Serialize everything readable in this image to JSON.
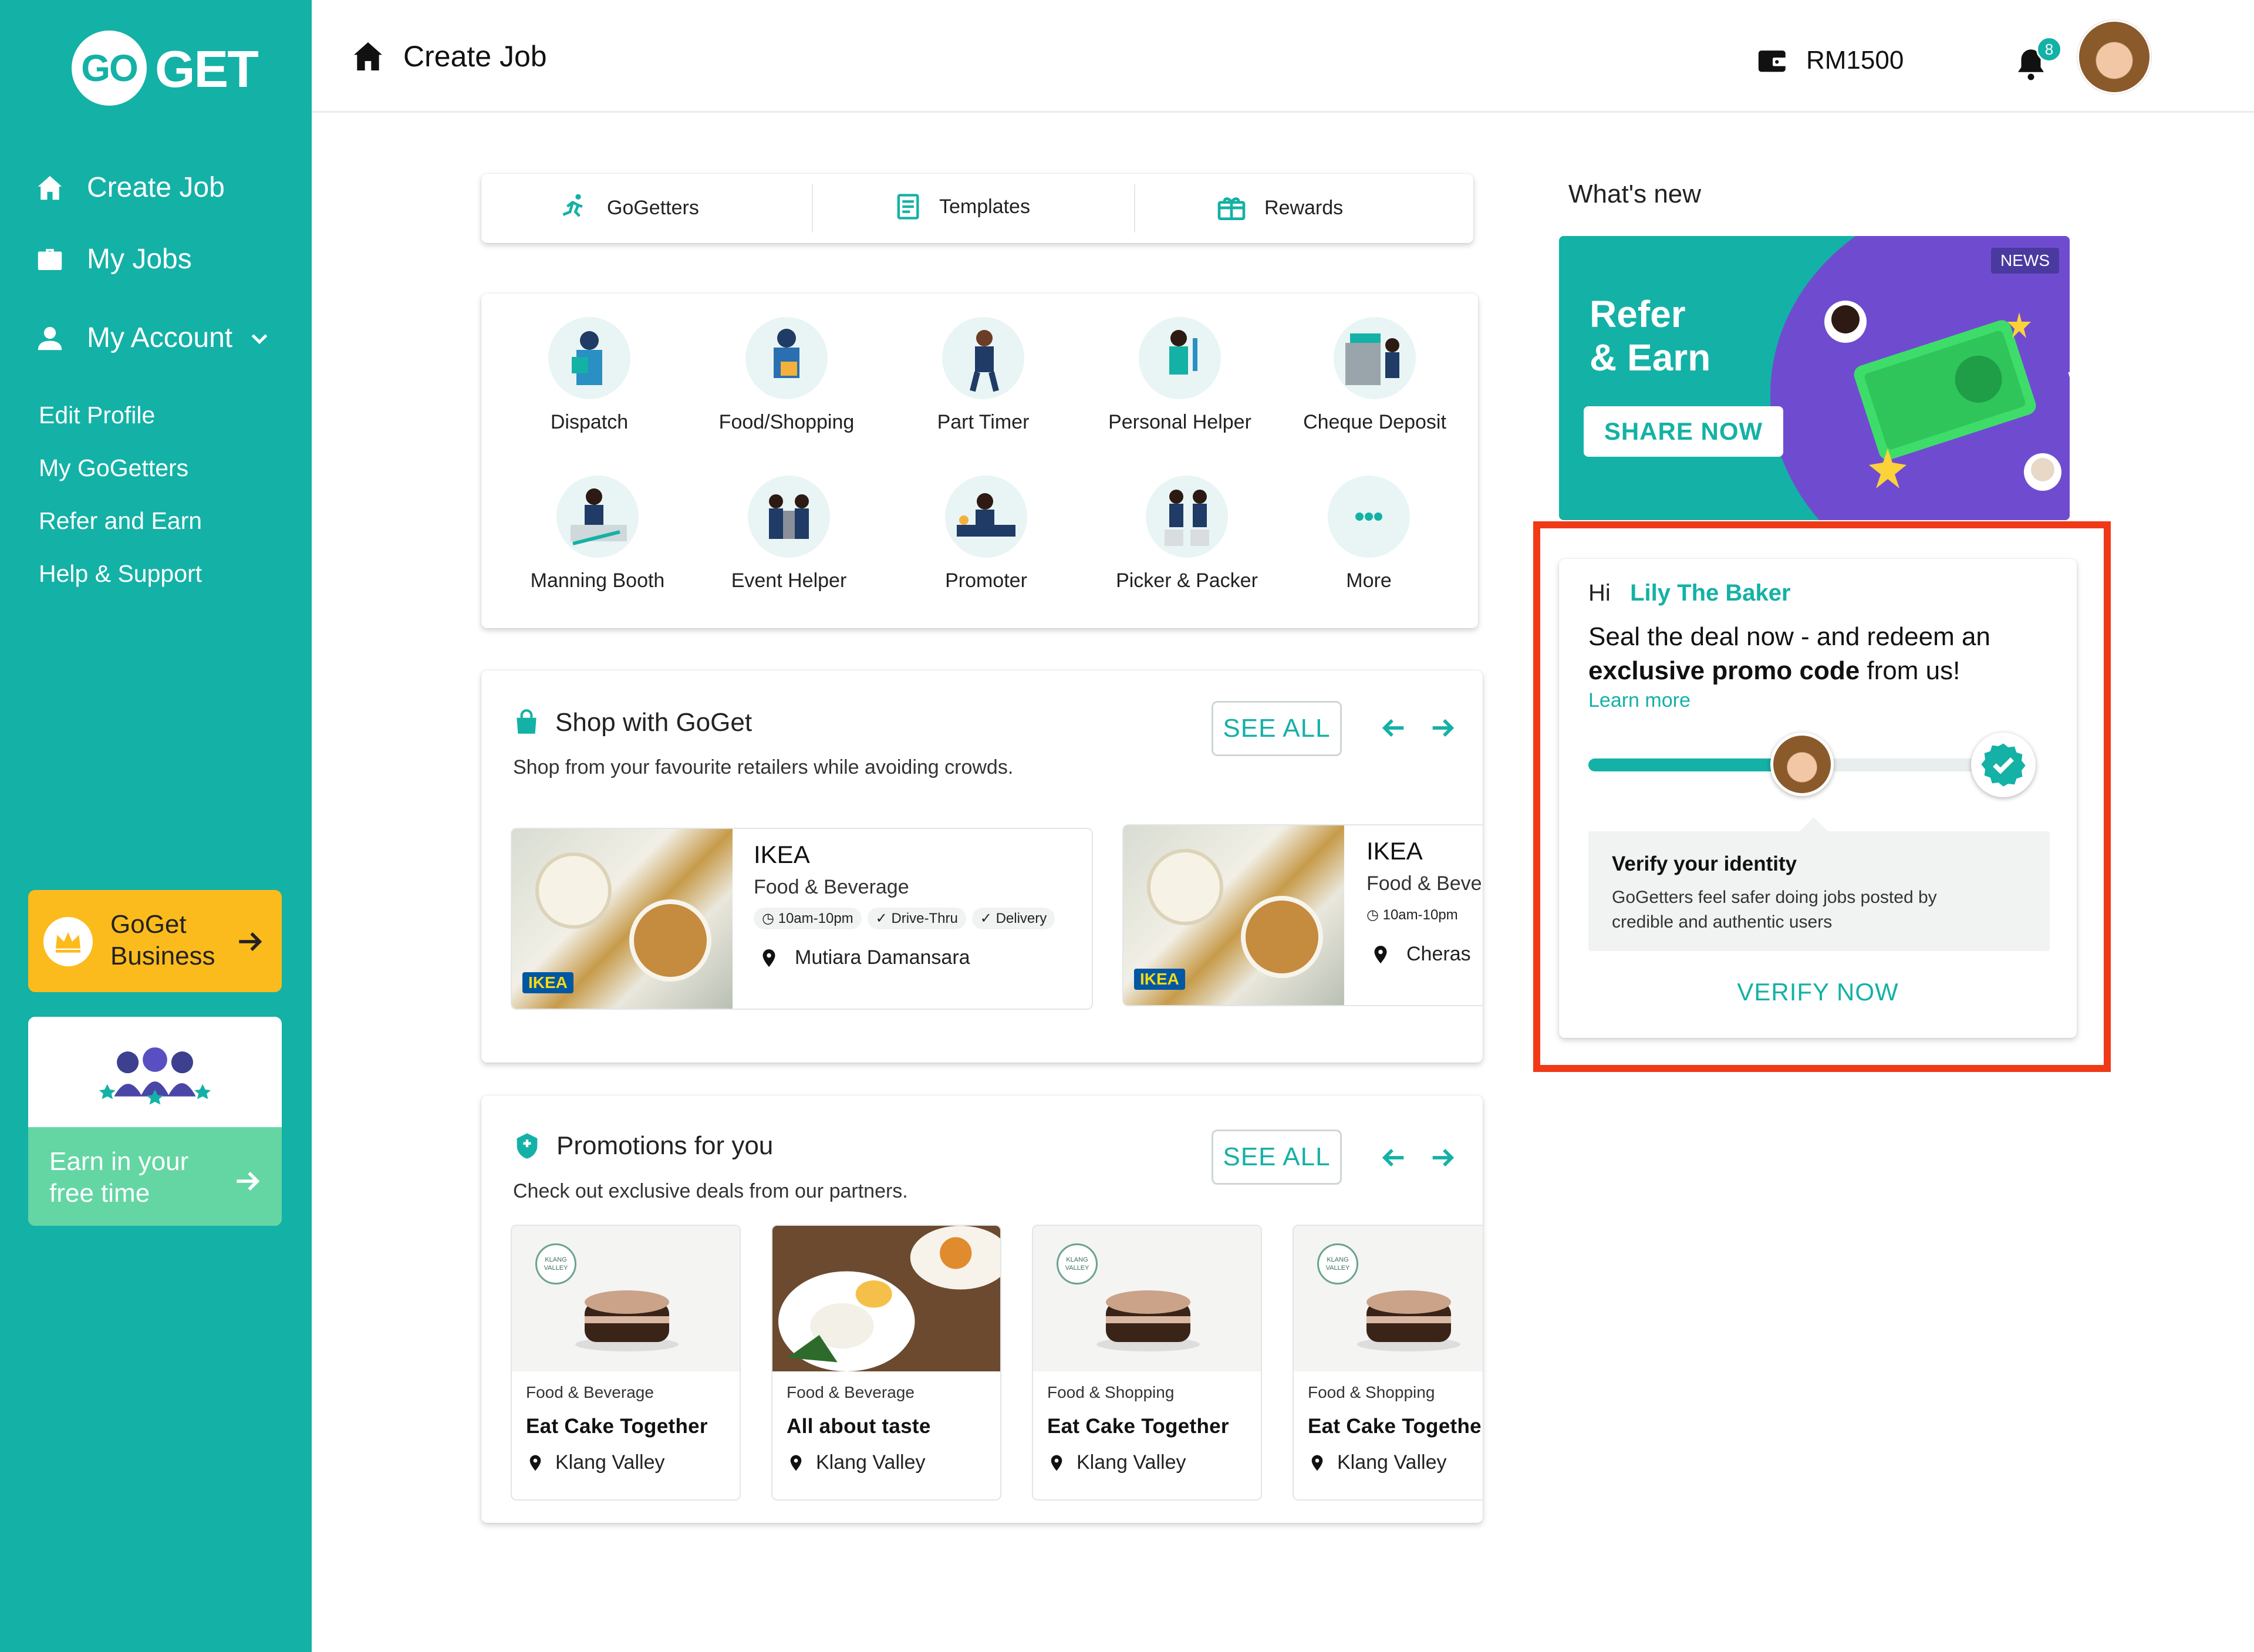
{
  "brand": {
    "logo_left": "GO",
    "logo_right": "GET"
  },
  "sidebar": {
    "main_items": [
      {
        "label": "Create Job",
        "icon": "home-icon"
      },
      {
        "label": "My Jobs",
        "icon": "briefcase-icon"
      },
      {
        "label": "My Account",
        "icon": "user-icon"
      }
    ],
    "account_subitems": [
      "Edit Profile",
      "My GoGetters",
      "Refer and Earn",
      "Help & Support"
    ],
    "business_promo": {
      "line1": "GoGet",
      "line2": "Business"
    },
    "earn_promo": {
      "line1": "Earn in your",
      "line2": "free time"
    }
  },
  "header": {
    "title": "Create Job",
    "wallet": "RM1500",
    "notification_count": "8"
  },
  "quick_tabs": [
    {
      "label": "GoGetters",
      "icon": "runner-icon"
    },
    {
      "label": "Templates",
      "icon": "templates-icon"
    },
    {
      "label": "Rewards",
      "icon": "gift-icon"
    }
  ],
  "services": {
    "row1": [
      "Dispatch",
      "Food/Shopping",
      "Part Timer",
      "Personal Helper",
      "Cheque Deposit"
    ],
    "row2": [
      "Manning Booth",
      "Event Helper",
      "Promoter",
      "Picker & Packer",
      "More"
    ]
  },
  "shop": {
    "title": "Shop with GoGet",
    "subtitle": "Shop from your favourite retailers while avoiding crowds.",
    "see_all": "SEE ALL",
    "stores": [
      {
        "name": "IKEA",
        "category": "Food & Beverage",
        "hours": "10am-10pm",
        "tags": [
          "Drive-Thru",
          "Delivery"
        ],
        "location": "Mutiara Damansara",
        "badge": "IKEA"
      },
      {
        "name": "IKEA",
        "category": "Food & Beve",
        "hours": "10am-10pm",
        "location": "Cheras",
        "badge": "IKEA"
      }
    ]
  },
  "promotions": {
    "title": "Promotions for you",
    "subtitle": "Check out exclusive deals from our partners.",
    "see_all": "SEE ALL",
    "items": [
      {
        "category": "Food & Beverage",
        "title": "Eat Cake Together",
        "location": "Klang Valley",
        "image": "cake"
      },
      {
        "category": "Food & Beverage",
        "title": "All about taste",
        "location": "Klang Valley",
        "image": "rice"
      },
      {
        "category": "Food & Shopping",
        "title": "Eat Cake Together",
        "location": "Klang Valley",
        "image": "cake"
      },
      {
        "category": "Food & Shopping",
        "title": "Eat Cake Together",
        "location": "Klang Valley",
        "image": "cake"
      }
    ],
    "klang_badge": "KLANG VALLEY"
  },
  "whats_new": {
    "heading": "What's new",
    "banner": {
      "tag": "NEWS",
      "line1": "Refer",
      "line2": "& Earn",
      "button": "SHARE NOW",
      "money": "RM"
    }
  },
  "verify": {
    "greeting": "Hi",
    "name": "Lily The Baker",
    "message_line1": "Seal the deal now - and redeem an",
    "message_bold": "exclusive promo code",
    "message_tail": "from us!",
    "learn_more": "Learn more",
    "progress": 0.55,
    "info_title": "Verify your identity",
    "info_text_line1": "GoGetters feel safer doing jobs posted by",
    "info_text_line2": "credible and authentic users",
    "button": "VERIFY NOW"
  },
  "colors": {
    "primary": "#14b1a6",
    "accent_yellow": "#fcbb1c",
    "highlight": "#f03a17",
    "purple": "#6f4ccf"
  }
}
